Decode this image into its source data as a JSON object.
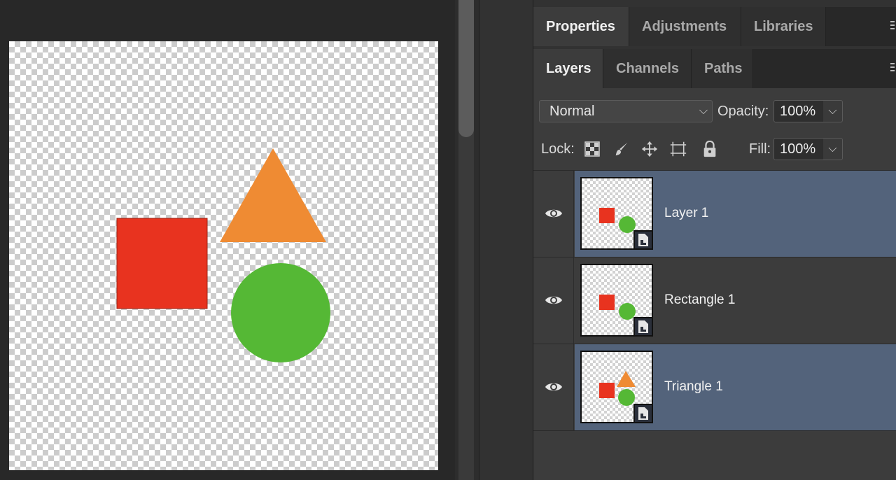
{
  "panels": {
    "top_tabs": [
      {
        "label": "Properties",
        "active": true
      },
      {
        "label": "Adjustments",
        "active": false
      },
      {
        "label": "Libraries",
        "active": false
      }
    ],
    "layer_tabs": [
      {
        "label": "Layers",
        "active": true
      },
      {
        "label": "Channels",
        "active": false
      },
      {
        "label": "Paths",
        "active": false
      }
    ]
  },
  "layers_panel": {
    "blend_mode": "Normal",
    "opacity_label": "Opacity:",
    "opacity_value": "100%",
    "lock_label": "Lock:",
    "fill_label": "Fill:",
    "fill_value": "100%",
    "lock_icons": [
      "lock-transparent-pixels-icon",
      "lock-image-pixels-icon",
      "lock-position-icon",
      "lock-artboard-icon",
      "lock-all-icon"
    ],
    "layers": [
      {
        "name": "Layer 1",
        "selected": true,
        "visible": true,
        "thumb_shapes": [
          "square",
          "circle"
        ]
      },
      {
        "name": "Rectangle 1",
        "selected": false,
        "visible": true,
        "thumb_shapes": [
          "square",
          "circle"
        ]
      },
      {
        "name": "Triangle 1",
        "selected": true,
        "visible": true,
        "thumb_shapes": [
          "square",
          "circle",
          "triangle"
        ]
      }
    ]
  },
  "colors": {
    "square": "#e8331f",
    "triangle": "#ef8b33",
    "circle": "#55b835",
    "selection": "#53637b"
  }
}
